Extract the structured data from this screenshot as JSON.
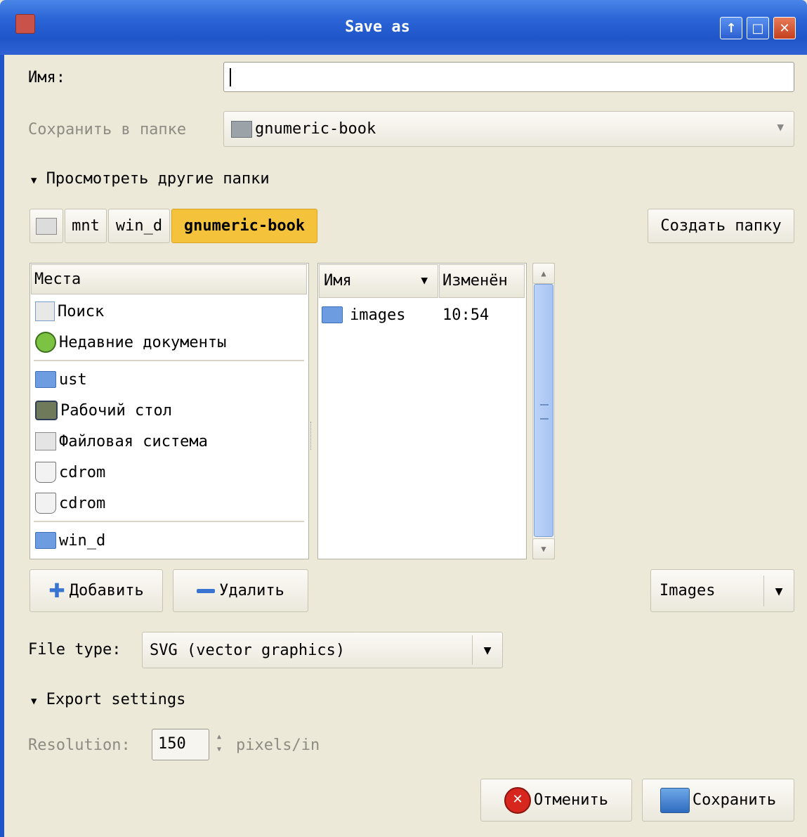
{
  "window": {
    "title": "Save as"
  },
  "name_field": {
    "label": "Имя:",
    "value": ""
  },
  "save_in": {
    "label": "Сохранить в папке",
    "value": "gnumeric-book"
  },
  "browse_toggle": {
    "label": "Просмотреть другие папки"
  },
  "path_bar": {
    "segments": [
      "mnt",
      "win_d",
      "gnumeric-book"
    ]
  },
  "create_folder_button": "Создать папку",
  "places": {
    "header": "Места",
    "items": [
      "Поиск",
      "Недавние документы",
      "ust",
      "Рабочий стол",
      "Файловая система",
      "cdrom",
      "cdrom",
      "win_d"
    ]
  },
  "files": {
    "columns": {
      "name": "Имя",
      "modified": "Изменён"
    },
    "rows": [
      {
        "name": "images",
        "modified": "10:54"
      }
    ]
  },
  "add_button": "Добавить",
  "remove_button": "Удалить",
  "filter_select": "Images",
  "file_type": {
    "label": "File type:",
    "value": "SVG (vector graphics)"
  },
  "export_toggle": {
    "label": "Export settings"
  },
  "resolution": {
    "label": "Resolution:",
    "value": "150",
    "unit": "pixels/in"
  },
  "cancel_button": "Отменить",
  "save_button": "Сохранить",
  "colors": {
    "titlebar": "#2a64d6",
    "dialog_bg": "#ece9d8",
    "path_active": "#f5c33b"
  }
}
